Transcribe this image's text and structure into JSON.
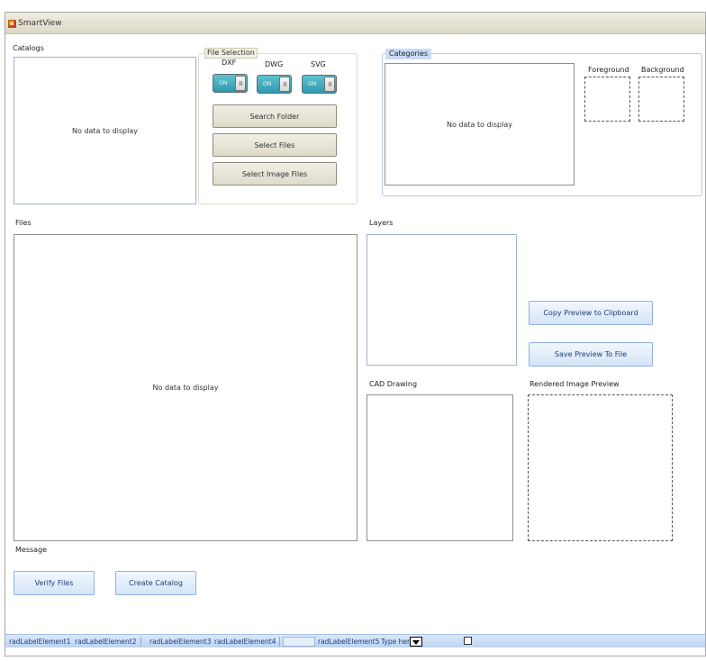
{
  "window": {
    "title": "SmartView"
  },
  "catalogs": {
    "label": "Catalogs",
    "empty_text": "No data to display"
  },
  "file_selection": {
    "label": "File Selection",
    "toggles": [
      {
        "label": "DXF",
        "state": "ON"
      },
      {
        "label": "DWG",
        "state": "ON"
      },
      {
        "label": "SVG",
        "state": "ON"
      }
    ],
    "buttons": {
      "search_folder": "Search Folder",
      "select_files": "Select Files",
      "select_image_files": "Select Image Files"
    }
  },
  "categories": {
    "label": "Categories",
    "empty_text": "No data to display",
    "foreground_label": "Foreground",
    "background_label": "Background"
  },
  "files": {
    "label": "Files",
    "empty_text": "No data to display"
  },
  "layers": {
    "label": "Layers"
  },
  "preview_actions": {
    "copy": "Copy Preview to Clipboard",
    "save": "Save Preview To File"
  },
  "cad_drawing": {
    "label": "CAD Drawing"
  },
  "rendered_preview": {
    "label": "Rendered Image Preview"
  },
  "message": {
    "label": "Message"
  },
  "actions": {
    "verify": "Verify Files",
    "create_catalog": "Create Catalog"
  },
  "statusbar": {
    "element1": "radLabelElement1",
    "element2": "radLabelElement2",
    "element3": "radLabelElement3",
    "element4": "radLabelElement4",
    "element5": "radLabelElement5",
    "type_here": "Type her"
  },
  "colors": {
    "accent": "#c9dcf5",
    "toggle_on": "#2e9aae",
    "panel_border": "#9db3cf"
  }
}
